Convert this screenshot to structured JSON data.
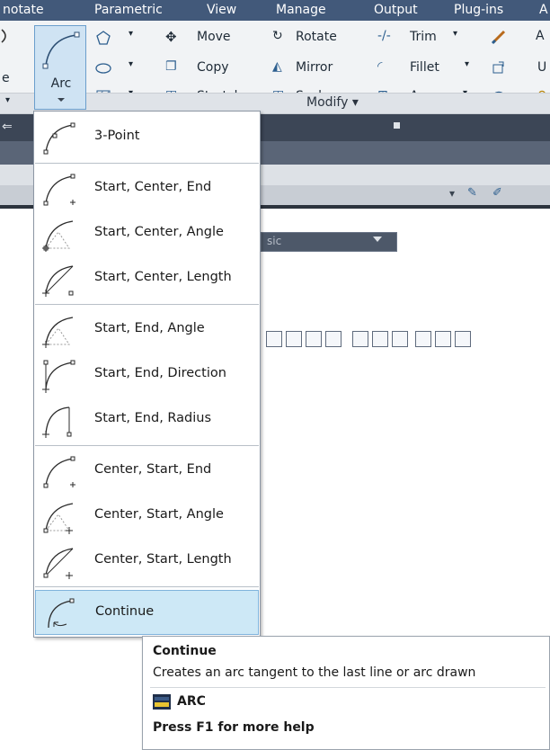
{
  "ribbon_tabs": [
    "notate",
    "Parametric",
    "View",
    "Manage",
    "Output",
    "Plug-ins",
    "A"
  ],
  "arc_button": {
    "label": "Arc"
  },
  "modify": {
    "move": "Move",
    "rotate": "Rotate",
    "trim": "Trim",
    "copy": "Copy",
    "mirror": "Mirror",
    "fillet": "Fillet",
    "stretch": "Stretch",
    "scale": "Scale",
    "array": "Array",
    "panel_title": "Modify ▾"
  },
  "left_edge_partial": {
    "row2_letter": "e"
  },
  "right_edge_partial": {
    "row2_letter": "U"
  },
  "visual_style_field": {
    "text": "sic"
  },
  "arc_menu": {
    "items": [
      {
        "label": "3-Point",
        "icon": "arc-3point-icon"
      },
      {
        "label": "Start, Center, End",
        "icon": "arc-start-center-end-icon"
      },
      {
        "label": "Start, Center, Angle",
        "icon": "arc-start-center-angle-icon"
      },
      {
        "label": "Start, Center, Length",
        "icon": "arc-start-center-length-icon"
      },
      {
        "label": "Start, End, Angle",
        "icon": "arc-start-end-angle-icon"
      },
      {
        "label": "Start, End, Direction",
        "icon": "arc-start-end-direction-icon"
      },
      {
        "label": "Start, End, Radius",
        "icon": "arc-start-end-radius-icon"
      },
      {
        "label": "Center, Start, End",
        "icon": "arc-center-start-end-icon"
      },
      {
        "label": "Center, Start, Angle",
        "icon": "arc-center-start-angle-icon"
      },
      {
        "label": "Center, Start, Length",
        "icon": "arc-center-start-length-icon"
      },
      {
        "label": "Continue",
        "icon": "arc-continue-icon",
        "highlighted": true
      }
    ]
  },
  "tooltip": {
    "title": "Continue",
    "description": "Creates an arc tangent to the last line or arc drawn",
    "command": "ARC",
    "help": "Press F1 for more help"
  },
  "colors": {
    "tab_bar": "#42597a",
    "highlight": "#cde8f6",
    "highlight_border": "#7fb3dc"
  }
}
